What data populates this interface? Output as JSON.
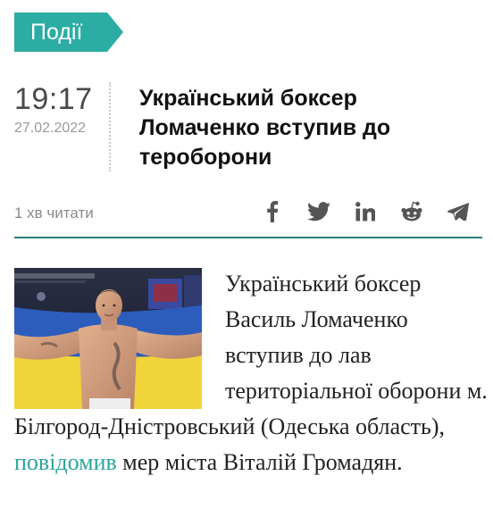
{
  "category": {
    "label": "Події",
    "color": "#2bada3"
  },
  "time": {
    "clock": "19:17",
    "date": "27.02.2022"
  },
  "headline": "Український боксер Ломаченко вступив до тероборони",
  "meta": {
    "read_time": "1 хв читати",
    "share_icons": [
      "facebook-icon",
      "twitter-icon",
      "linkedin-icon",
      "reddit-icon",
      "telegram-icon"
    ]
  },
  "article": {
    "photo": "boxer-with-ukrainian-flag",
    "text_before_link": "Український боксер Василь Ломаченко вступив до лав територіальної оборони м. Білгород-Дністровський (Одеська область), ",
    "link_text": "повідомив",
    "text_after_link": " мер міста Віталій Громадян.",
    "link_color": "#2aa59d"
  }
}
